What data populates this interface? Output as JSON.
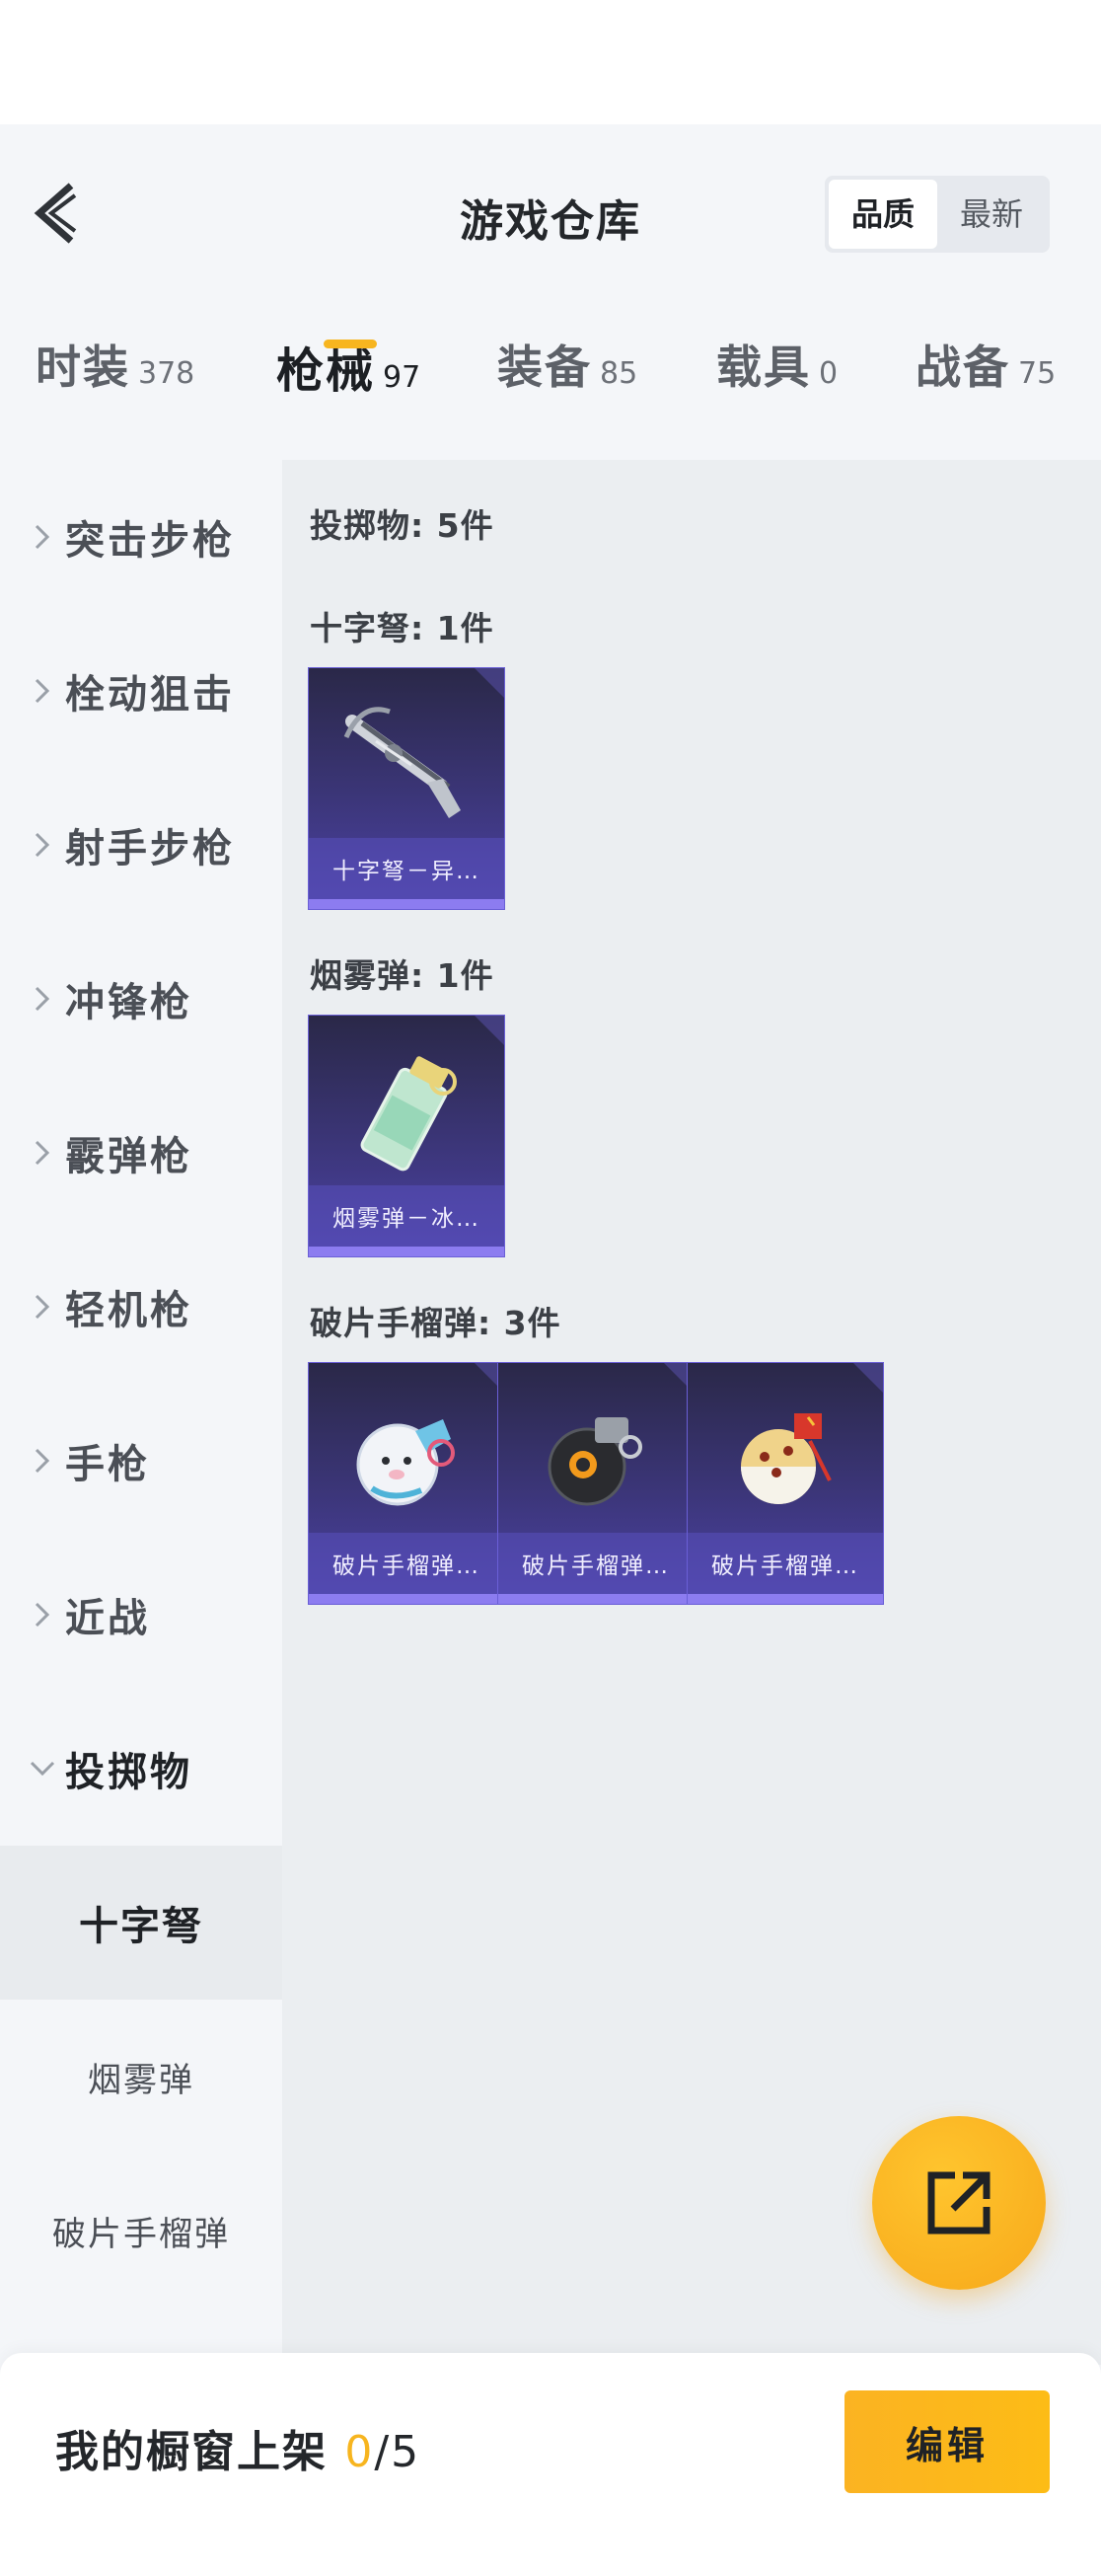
{
  "header": {
    "title": "游戏仓库",
    "back_icon": "chevron-left-icon",
    "sort_options": [
      {
        "label": "品质",
        "active": true
      },
      {
        "label": "最新",
        "active": false
      }
    ]
  },
  "tabs": [
    {
      "label": "时装",
      "count": "378",
      "active": false
    },
    {
      "label": "枪械",
      "count": "97",
      "active": true
    },
    {
      "label": "装备",
      "count": "85",
      "active": false
    },
    {
      "label": "载具",
      "count": "0",
      "active": false
    },
    {
      "label": "战备",
      "count": "75",
      "active": false
    }
  ],
  "sidebar": {
    "items": [
      {
        "label": "突击步枪",
        "expanded": false
      },
      {
        "label": "栓动狙击",
        "expanded": false
      },
      {
        "label": "射手步枪",
        "expanded": false
      },
      {
        "label": "冲锋枪",
        "expanded": false
      },
      {
        "label": "霰弹枪",
        "expanded": false
      },
      {
        "label": "轻机枪",
        "expanded": false
      },
      {
        "label": "手枪",
        "expanded": false
      },
      {
        "label": "近战",
        "expanded": false
      },
      {
        "label": "投掷物",
        "expanded": true
      }
    ],
    "sub_items": [
      {
        "label": "十字弩",
        "active": true
      },
      {
        "label": "烟雾弹",
        "active": false
      },
      {
        "label": "破片手榴弹",
        "active": false
      }
    ]
  },
  "content": {
    "summary": "投掷物: 5件",
    "sections": [
      {
        "title": "十字弩: 1件",
        "items": [
          {
            "name": "十字弩－异…",
            "icon": "crossbow-icon"
          }
        ]
      },
      {
        "title": "烟雾弹: 1件",
        "items": [
          {
            "name": "烟雾弹－冰…",
            "icon": "smoke-grenade-icon"
          }
        ]
      },
      {
        "title": "破片手榴弹: 3件",
        "items": [
          {
            "name": "破片手榴弹…",
            "icon": "grenade-seal-icon"
          },
          {
            "name": "破片手榴弹…",
            "icon": "grenade-black-icon"
          },
          {
            "name": "破片手榴弹…",
            "icon": "grenade-gold-icon"
          }
        ]
      }
    ]
  },
  "fab": {
    "icon": "share-external-icon"
  },
  "bottom": {
    "showcase_label": "我的橱窗上架",
    "showcase_current": "0",
    "showcase_sep": "/",
    "showcase_max": "5",
    "edit_label": "编辑"
  },
  "colors": {
    "accent": "#F7B51F",
    "card_bg": "#3C367A",
    "card_border": "#8C7CF0"
  }
}
